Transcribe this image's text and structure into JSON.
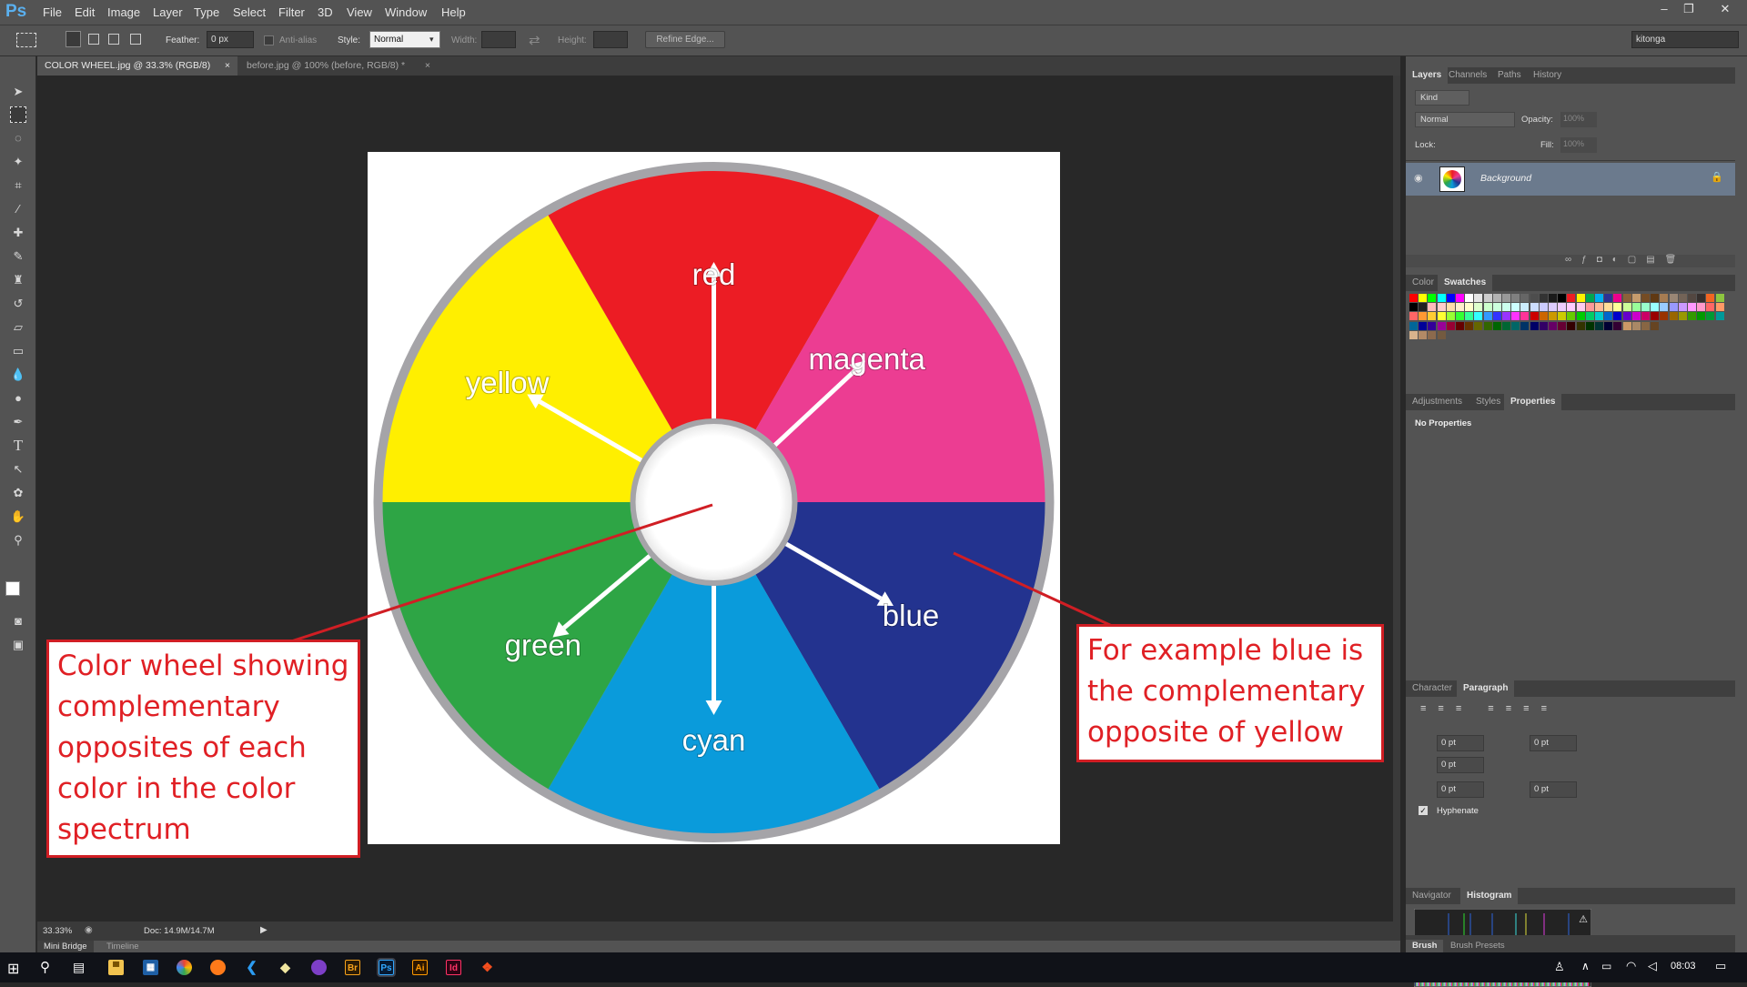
{
  "app": {
    "logo": "Ps"
  },
  "menu": [
    "File",
    "Edit",
    "Image",
    "Layer",
    "Type",
    "Select",
    "Filter",
    "3D",
    "View",
    "Window",
    "Help"
  ],
  "window_controls": {
    "minimize": "–",
    "restore": "❐",
    "close": "✕"
  },
  "options": {
    "feather_label": "Feather:",
    "feather_value": "0 px",
    "antialias_label": "Anti-alias",
    "style_label": "Style:",
    "style_value": "Normal",
    "width_label": "Width:",
    "height_label": "Height:",
    "refine_edge": "Refine Edge...",
    "workspace": "kitonga"
  },
  "tabs": [
    {
      "label": "COLOR WHEEL.jpg @ 33.3% (RGB/8)",
      "close": "×",
      "active": true
    },
    {
      "label": "before.jpg @ 100% (before, RGB/8) *",
      "close": "×",
      "active": false
    }
  ],
  "status": {
    "zoom": "33.33%",
    "doc": "Doc: 14.9M/14.7M"
  },
  "bottom_tabs": [
    "Mini Bridge",
    "Timeline"
  ],
  "wheel": {
    "labels": {
      "red": "red",
      "magenta": "magenta",
      "blue": "blue",
      "cyan": "cyan",
      "green": "green",
      "yellow": "yellow"
    },
    "colors": {
      "red": "#ec1c24",
      "magenta": "#ec3d92",
      "blue": "#23338f",
      "cyan": "#0a9bdb",
      "green": "#2ea545",
      "yellow": "#ffef00"
    }
  },
  "annotations": {
    "left": [
      "Color wheel showing",
      "complementary",
      "opposites of each",
      "color in the color",
      "spectrum"
    ],
    "right": [
      "For example blue is",
      "the complementary",
      "opposite of yellow"
    ],
    "border_color": "#d01e24"
  },
  "panels": {
    "layers_tabs": [
      "Layers",
      "Channels",
      "Paths",
      "History"
    ],
    "kind_label": "Kind",
    "blend_mode": "Normal",
    "opacity_label": "Opacity:",
    "opacity_value": "100%",
    "lock_label": "Lock:",
    "fill_label": "Fill:",
    "fill_value": "100%",
    "layer_name": "Background",
    "color_tabs": [
      "Color",
      "Swatches"
    ],
    "adjust_tabs": [
      "Adjustments",
      "Styles",
      "Properties"
    ],
    "no_properties": "No Properties",
    "char_tabs": [
      "Character",
      "Paragraph"
    ],
    "para_values": [
      "0 pt",
      "0 pt",
      "0 pt",
      "0 pt",
      "0 pt"
    ],
    "hyphenate": "Hyphenate",
    "nav_tabs": [
      "Navigator",
      "Histogram"
    ],
    "brush_tabs": [
      "Brush",
      "Brush Presets"
    ]
  },
  "taskbar": {
    "app_icons": [
      "Br",
      "Ps",
      "Ai",
      "Id"
    ],
    "clock": "08:03"
  }
}
